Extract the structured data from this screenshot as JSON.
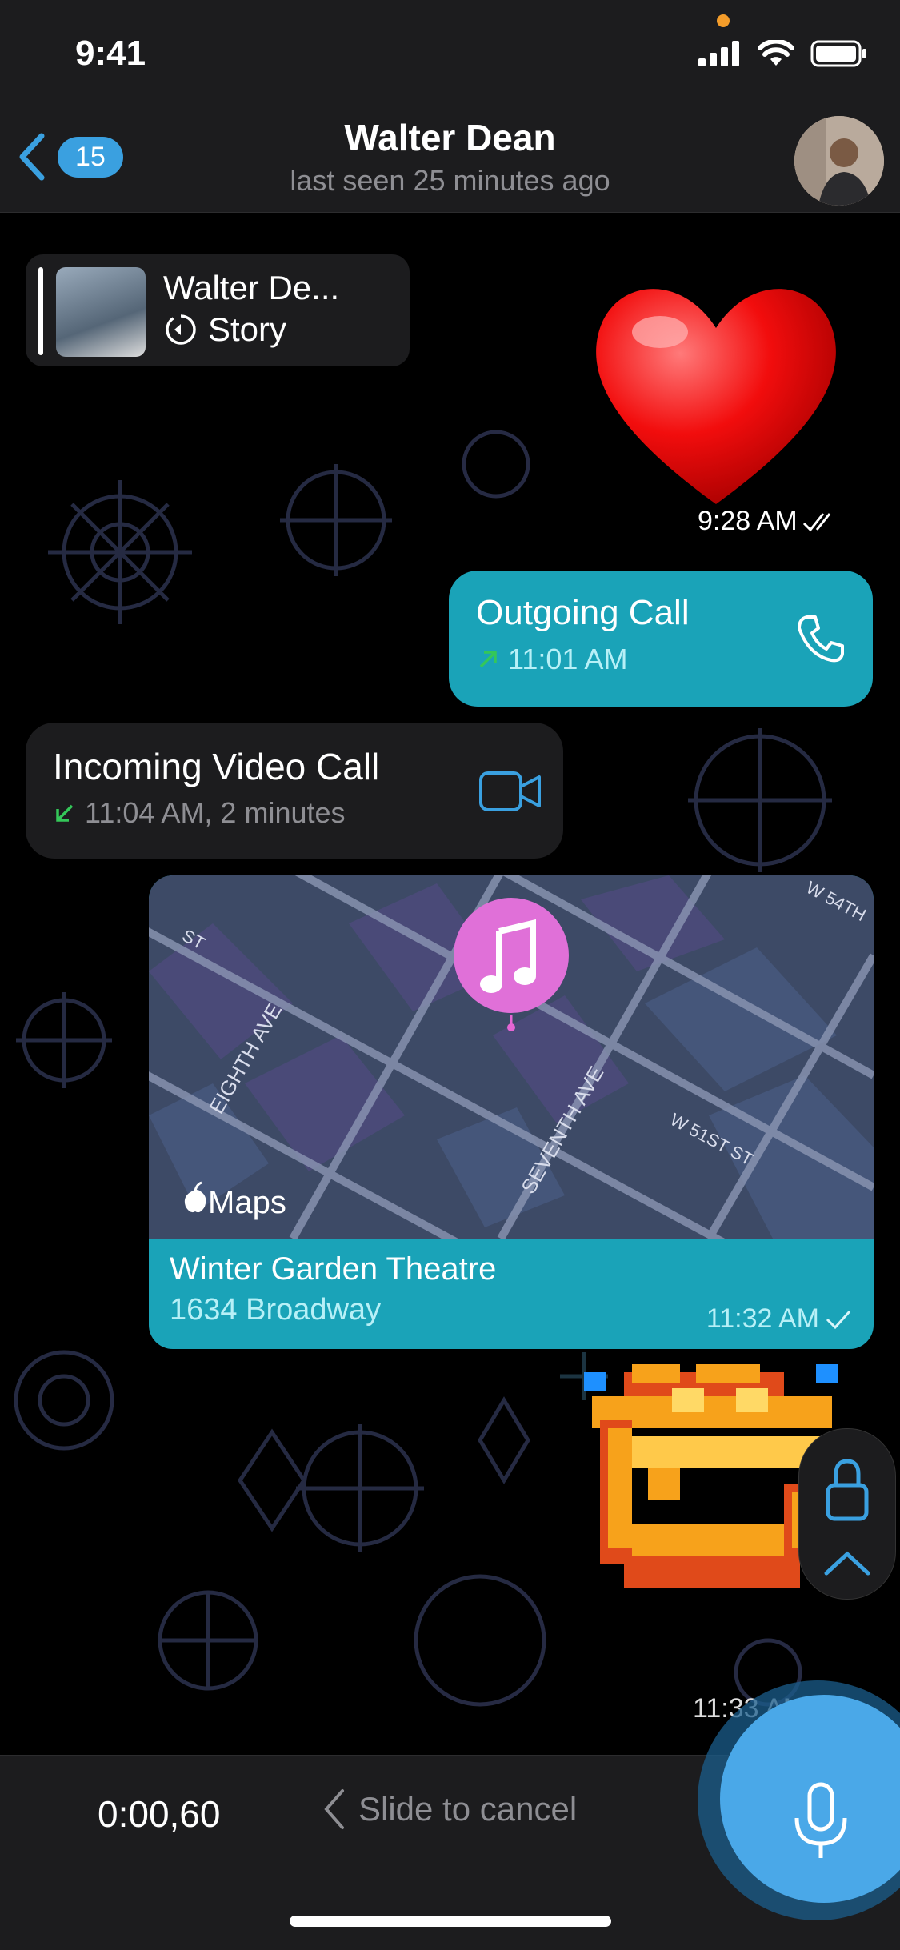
{
  "status_bar": {
    "time": "9:41"
  },
  "header": {
    "back_count": "15",
    "title": "Walter Dean",
    "subtitle": "last seen 25 minutes ago"
  },
  "messages": {
    "story_reply": {
      "name": "Walter De...",
      "label": "Story"
    },
    "heart": {
      "time": "9:28 AM"
    },
    "outgoing_call": {
      "label": "Outgoing Call",
      "time": "11:01 AM"
    },
    "incoming_call": {
      "label": "Incoming Video Call",
      "time": "11:04 AM, 2 minutes"
    },
    "location": {
      "map_brand": "Maps",
      "street_labels": [
        "EIGHTH AVE",
        "SEVENTH AVE",
        "W 51ST ST",
        "W 54TH",
        "ST"
      ],
      "place_name": "Winter Garden Theatre",
      "address": "1634 Broadway",
      "time": "11:32 AM"
    },
    "sticker": {
      "time": "11:33 AM"
    }
  },
  "recording": {
    "timer": "0:00,60",
    "cancel_hint": "Slide to cancel"
  },
  "colors": {
    "accent": "#3aa0e0",
    "outgoing_bubble": "#1aa3b8",
    "incoming_bubble": "#1c1c1e",
    "call_arrow": "#34c759"
  }
}
